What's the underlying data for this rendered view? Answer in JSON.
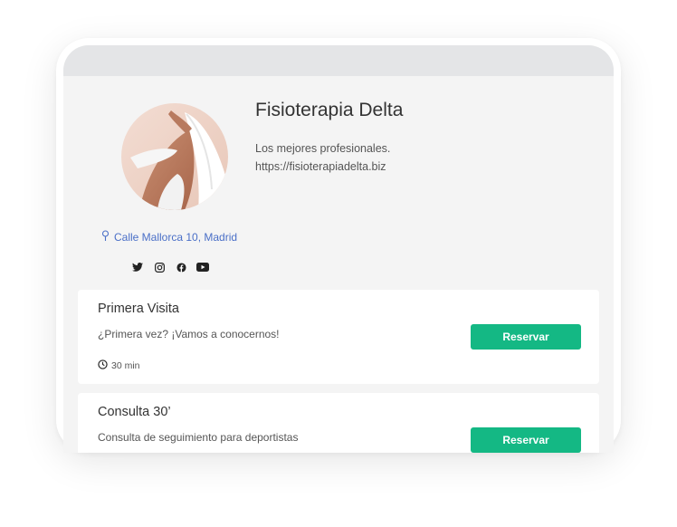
{
  "business": {
    "name": "Fisioterapia Delta",
    "tagline": "Los mejores profesionales.",
    "website": "https://fisioterapiadelta.biz",
    "address": "Calle Mallorca 10, Madrid"
  },
  "social_icons": [
    "twitter-icon",
    "instagram-icon",
    "facebook-icon",
    "youtube-icon"
  ],
  "services": [
    {
      "title": "Primera Visita",
      "description": "¿Primera vez? ¡Vamos a conocernos!",
      "duration": "30 min",
      "button_label": "Reservar"
    },
    {
      "title": "Consulta 30’",
      "description": "Consulta de seguimiento para deportistas",
      "button_label": "Reservar"
    }
  ],
  "colors": {
    "accent": "#14b884",
    "link": "#4a6fc7",
    "background": "#f4f4f4",
    "topbar": "#e4e5e7"
  }
}
